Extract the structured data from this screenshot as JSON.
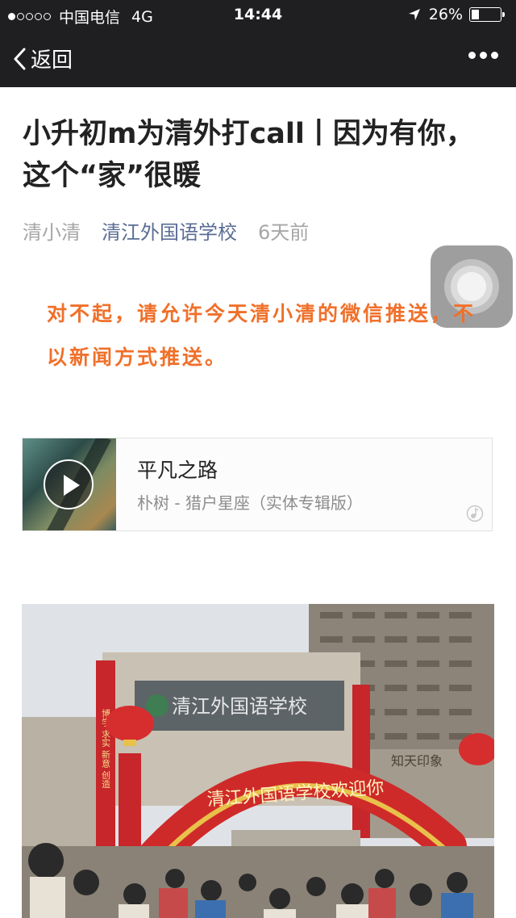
{
  "status_bar": {
    "carrier": "中国电信",
    "network": "4G",
    "time": "14:44",
    "battery": "26%",
    "signal_bars_filled": 1,
    "signal_bars_total": 5,
    "battery_level": 0.26
  },
  "nav": {
    "back_label": "返回"
  },
  "article": {
    "title": "小升初m为清外打call丨因为有你，这个“家”很暖",
    "author": "清小清",
    "account": "清江外国语学校",
    "time": "6天前",
    "intro": "对不起，请允许今天清小清的微信推送，不以新闻方式推送。"
  },
  "music": {
    "song": "平凡之路",
    "artist": "朴树 - 猎户星座（实体专辑版）"
  },
  "photo": {
    "building_sign": "清江外国语学校",
    "arch_text": "清江外国语学校欢迎你",
    "left_banner": "博学 求实 新意 创造",
    "shop_sign": "知天印象"
  },
  "colors": {
    "nav_bg": "#1f1f22",
    "accent_link": "#5a6d95",
    "intro_text": "#f0702a"
  }
}
